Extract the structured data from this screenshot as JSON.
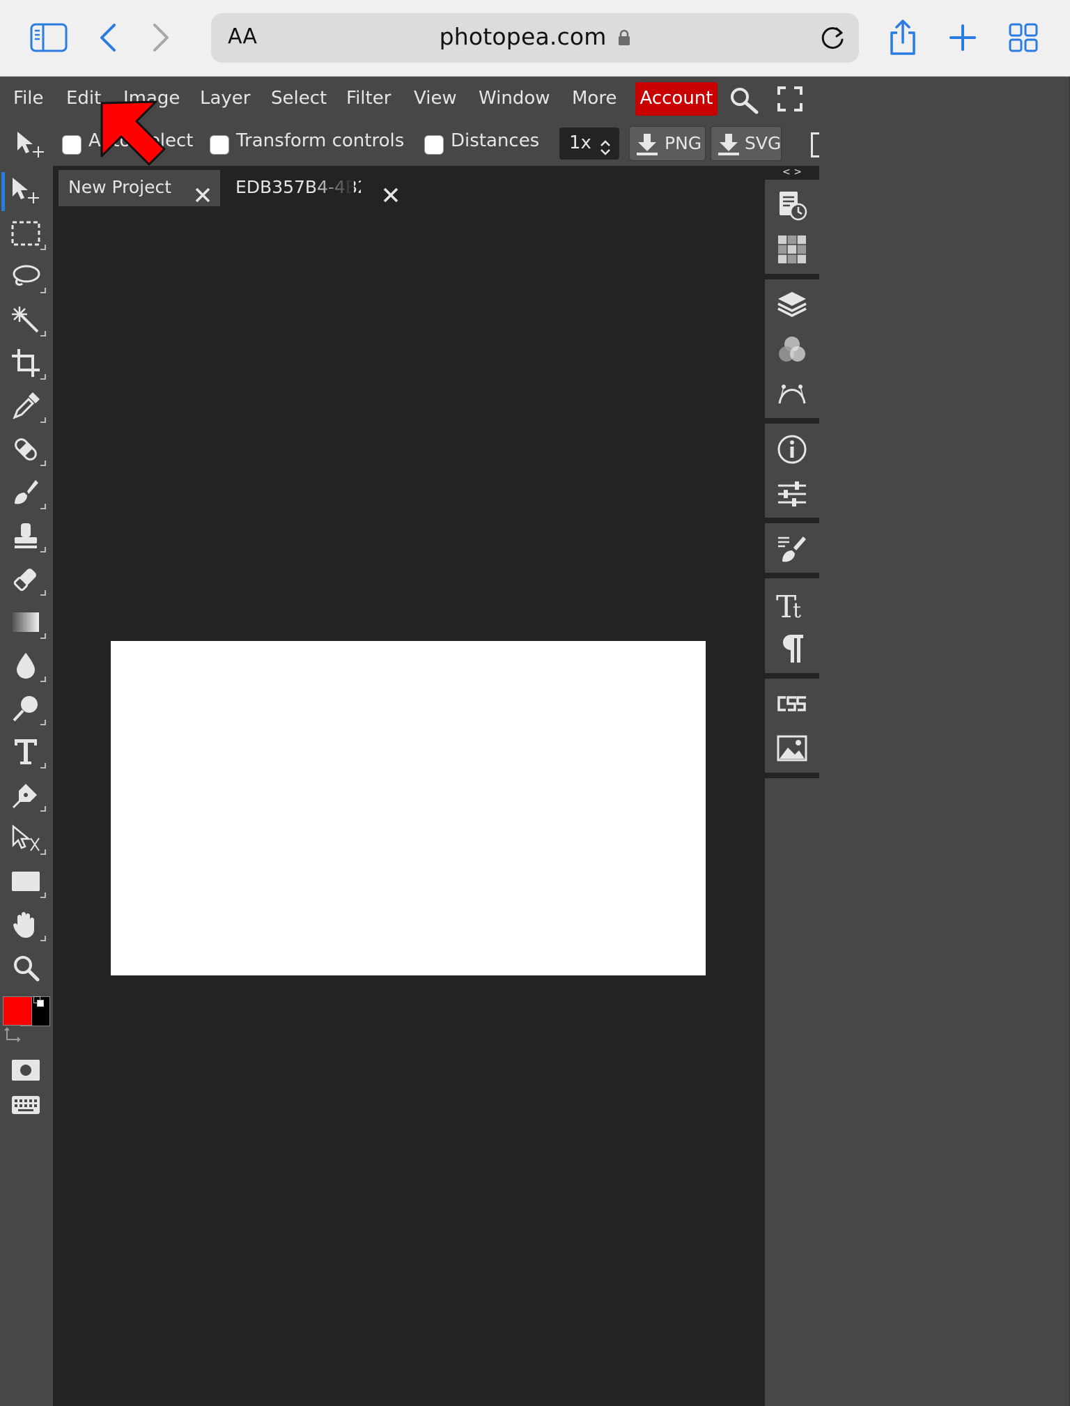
{
  "browser": {
    "text_size_button": "AA",
    "url": "photopea.com"
  },
  "menu": {
    "items": [
      "File",
      "Edit",
      "Image",
      "Layer",
      "Select",
      "Filter",
      "View",
      "Window",
      "More"
    ],
    "account": "Account"
  },
  "options": {
    "auto_select": "Auto-Select",
    "transform_controls": "Transform controls",
    "distances": "Distances",
    "scale": "1x",
    "png": "PNG",
    "svg": "SVG"
  },
  "tabs": [
    {
      "label": "New Project.",
      "active": true
    },
    {
      "label": "EDB357B4-4B2",
      "active": false
    }
  ],
  "panel": {
    "collapse": "< >"
  },
  "colors": {
    "foreground": "#ff0000",
    "background": "#000000",
    "accent": "#2a7ce0",
    "account": "#c80000"
  }
}
